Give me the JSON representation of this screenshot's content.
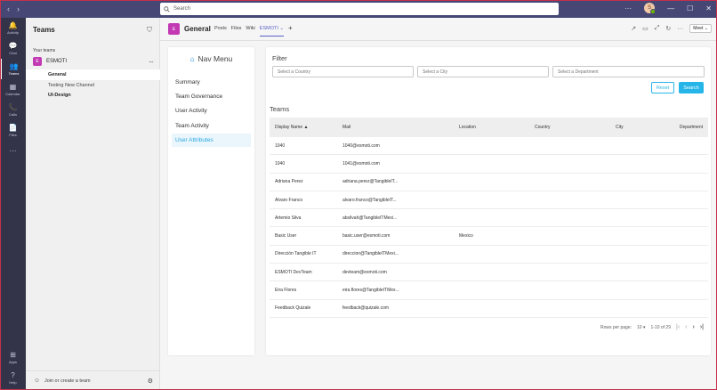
{
  "titlebar": {
    "back": "‹",
    "forward": "›",
    "search_placeholder": "Search",
    "more": "···",
    "avatar_initials": "S",
    "minimize": "—",
    "maximize": "☐",
    "close": "✕"
  },
  "rail": {
    "items": [
      {
        "label": "Activity",
        "icon": "🔔"
      },
      {
        "label": "Chat",
        "icon": "💬"
      },
      {
        "label": "Teams",
        "icon": "👥"
      },
      {
        "label": "Calendar",
        "icon": "▦"
      },
      {
        "label": "Calls",
        "icon": "📞"
      },
      {
        "label": "Files",
        "icon": "📄"
      }
    ],
    "more": "···",
    "apps_label": "Apps",
    "apps_icon": "⊞",
    "help_label": "Help",
    "help_icon": "?"
  },
  "teams_panel": {
    "title": "Teams",
    "filter_icon": "⛉",
    "section_label": "Your teams",
    "team": {
      "name": "ESMOTI",
      "initial": "E",
      "more": "···"
    },
    "channels": [
      "General",
      "Testing New Channel",
      "UI-Design"
    ],
    "join_label": "Join or create a team",
    "join_icon": "⚇",
    "settings_icon": "⚙"
  },
  "channel_header": {
    "initial": "E",
    "title": "General",
    "tabs": [
      "Posts",
      "Files",
      "Wiki",
      "ESMOTI"
    ],
    "active_tab_suffix": "⌄",
    "add_tab": "+",
    "meet_label": "Meet",
    "meet_caret": "⌄",
    "icons": [
      "↗",
      "▭",
      "⤢",
      "↻",
      "···"
    ]
  },
  "nav_menu": {
    "title": "Nav Menu",
    "home_icon": "⌂",
    "items": [
      "Summary",
      "Team Governance",
      "User Activity",
      "Team Activity",
      "User Attributes"
    ],
    "selected_index": 4
  },
  "filter": {
    "title": "Filter",
    "country_placeholder": "Select a Country",
    "city_placeholder": "Select a City",
    "department_placeholder": "Select a Department",
    "reset_label": "Reset",
    "search_label": "Search"
  },
  "table": {
    "title": "Teams",
    "columns": [
      "Display Name ▲",
      "Mail",
      "Location",
      "Country",
      "City",
      "Department"
    ],
    "rows": [
      [
        "1040",
        "1040@esmoti.com",
        "",
        "",
        "",
        ""
      ],
      [
        "1040",
        "1041@esmoti.com",
        "",
        "",
        "",
        ""
      ],
      [
        "Adriana Perez",
        "adriana.perez@TangibleIT...",
        "",
        "",
        "",
        ""
      ],
      [
        "Alvaro Franco",
        "alvaro.franco@TangibleIT...",
        "",
        "",
        "",
        ""
      ],
      [
        "Artemio Silva",
        "absilvah@TangibleITMexi...",
        "",
        "",
        "",
        ""
      ],
      [
        "Basic User",
        "basic.user@esmoti.com",
        "Mexico",
        "",
        "",
        ""
      ],
      [
        "Dirección Tangible IT",
        "direccion@TangibleITMexi...",
        "",
        "",
        "",
        ""
      ],
      [
        "ESMOTI DevTeam",
        "devteam@esmoti.com",
        "",
        "",
        "",
        ""
      ],
      [
        "Eira Flores",
        "eira.flores@TangibleITMex...",
        "",
        "",
        "",
        ""
      ],
      [
        "Feedback Quizale",
        "feedback@quizale.com",
        "",
        "",
        "",
        ""
      ]
    ]
  },
  "pagination": {
    "rows_per_page_label": "Rows per page:",
    "rows_per_page": "10",
    "caret": "▾",
    "range": "1-10 of 29",
    "first": "|‹",
    "prev": "‹",
    "next": "›",
    "last": "›|"
  }
}
